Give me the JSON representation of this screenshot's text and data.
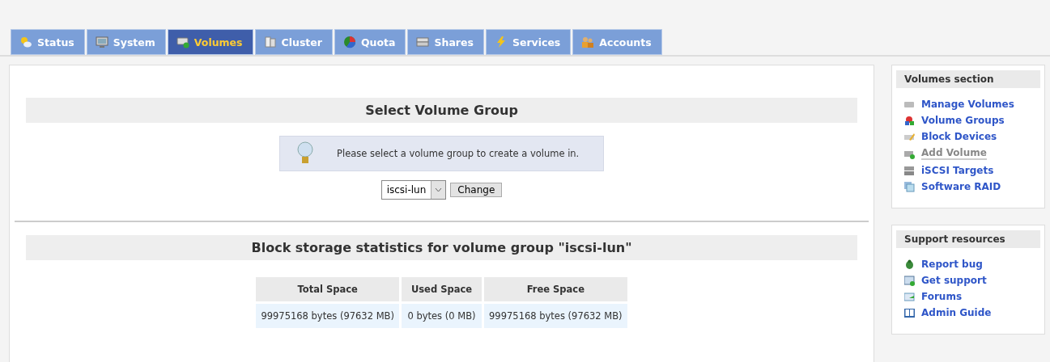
{
  "tabs": [
    {
      "label": "Status",
      "selected": false
    },
    {
      "label": "System",
      "selected": false
    },
    {
      "label": "Volumes",
      "selected": true
    },
    {
      "label": "Cluster",
      "selected": false
    },
    {
      "label": "Quota",
      "selected": false
    },
    {
      "label": "Shares",
      "selected": false
    },
    {
      "label": "Services",
      "selected": false
    },
    {
      "label": "Accounts",
      "selected": false
    }
  ],
  "select_section": {
    "title": "Select Volume Group",
    "info": "Please select a volume group to create a volume in.",
    "dropdown": {
      "value": "iscsi-lun"
    },
    "button": "Change"
  },
  "stats_section": {
    "title": "Block storage statistics for volume group \"iscsi-lun\"",
    "table": {
      "columns": [
        "Total Space",
        "Used Space",
        "Free Space"
      ],
      "rows": [
        [
          "99975168 bytes (97632 MB)",
          "0 bytes (0 MB)",
          "99975168 bytes (97632 MB)"
        ]
      ]
    }
  },
  "sidebar": [
    {
      "title": "Volumes section",
      "items": [
        {
          "label": "Manage Volumes",
          "selected": false
        },
        {
          "label": "Volume Groups",
          "selected": false
        },
        {
          "label": "Block Devices",
          "selected": false
        },
        {
          "label": "Add Volume",
          "selected": true
        },
        {
          "label": "iSCSI Targets",
          "selected": false
        },
        {
          "label": "Software RAID",
          "selected": false
        }
      ]
    },
    {
      "title": "Support resources",
      "items": [
        {
          "label": "Report bug",
          "selected": false
        },
        {
          "label": "Get support",
          "selected": false
        },
        {
          "label": "Forums",
          "selected": false
        },
        {
          "label": "Admin Guide",
          "selected": false
        }
      ]
    }
  ]
}
